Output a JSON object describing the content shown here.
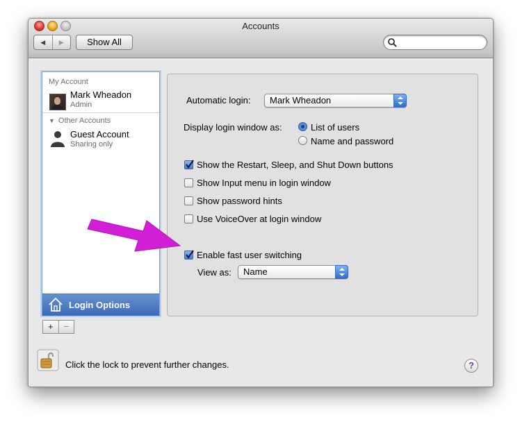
{
  "window": {
    "title": "Accounts"
  },
  "toolbar": {
    "show_all_label": "Show All",
    "search_placeholder": ""
  },
  "sidebar": {
    "my_account_heading": "My Account",
    "my_account": {
      "name": "Mark Wheadon",
      "role": "Admin"
    },
    "other_accounts_heading": "Other Accounts",
    "other_accounts": [
      {
        "name": "Guest Account",
        "role": "Sharing only"
      }
    ],
    "login_options_label": "Login Options",
    "add_label": "+",
    "remove_label": "−"
  },
  "login": {
    "automatic_login_label": "Automatic login:",
    "automatic_login_value": "Mark Wheadon",
    "display_as_label": "Display login window as:",
    "display_as_options": [
      {
        "label": "List of users",
        "selected": true
      },
      {
        "label": "Name and password",
        "selected": false
      }
    ],
    "checkboxes": [
      {
        "label": "Show the Restart, Sleep, and Shut Down buttons",
        "checked": true
      },
      {
        "label": "Show Input menu in login window",
        "checked": false
      },
      {
        "label": "Show password hints",
        "checked": false
      },
      {
        "label": "Use VoiceOver at login window",
        "checked": false
      },
      {
        "label": "Enable fast user switching",
        "checked": true
      }
    ],
    "view_as_label": "View as:",
    "view_as_value": "Name"
  },
  "footer": {
    "lock_text": "Click the lock to prevent further changes.",
    "help_label": "?"
  },
  "colors": {
    "accent": "#3c6ab9",
    "annotation_arrow": "#d21fd6"
  }
}
